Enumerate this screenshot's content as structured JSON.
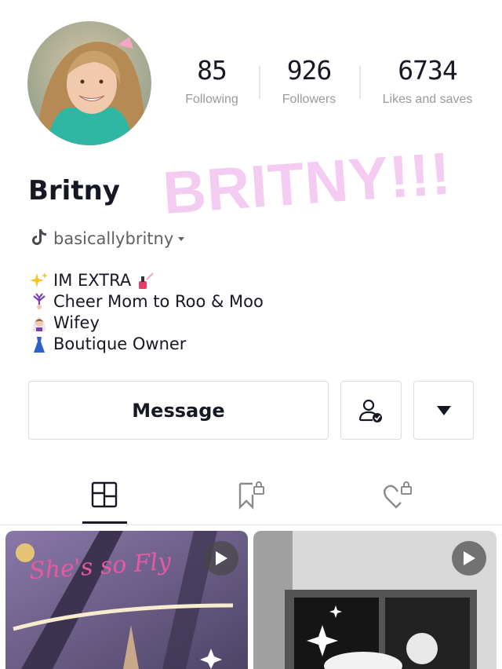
{
  "stats": [
    {
      "value": "85",
      "label": "Following"
    },
    {
      "value": "926",
      "label": "Followers"
    },
    {
      "value": "6734",
      "label": "Likes and saves"
    }
  ],
  "profile": {
    "display_name": "Britny",
    "overlay_text": "BRITNY!!!",
    "username": "basicallybritny"
  },
  "bio": [
    {
      "icon": "sparkles-icon",
      "text": "IM EXTRA"
    },
    {
      "icon": "cartwheel-icon",
      "text": "Cheer Mom to Roo & Moo"
    },
    {
      "icon": "bride-icon",
      "text": "Wifey"
    },
    {
      "icon": "dress-icon",
      "text": "Boutique Owner"
    }
  ],
  "buttons": {
    "message": "Message"
  },
  "tabs": [
    "videos-grid-icon",
    "saved-locked-icon",
    "liked-locked-icon"
  ],
  "thumbnails": [
    {
      "caption": "She's so Fly"
    }
  ],
  "colors": {
    "accent_overlay": "#f3c2ef",
    "text": "#161823",
    "muted": "#9a9a9e"
  }
}
